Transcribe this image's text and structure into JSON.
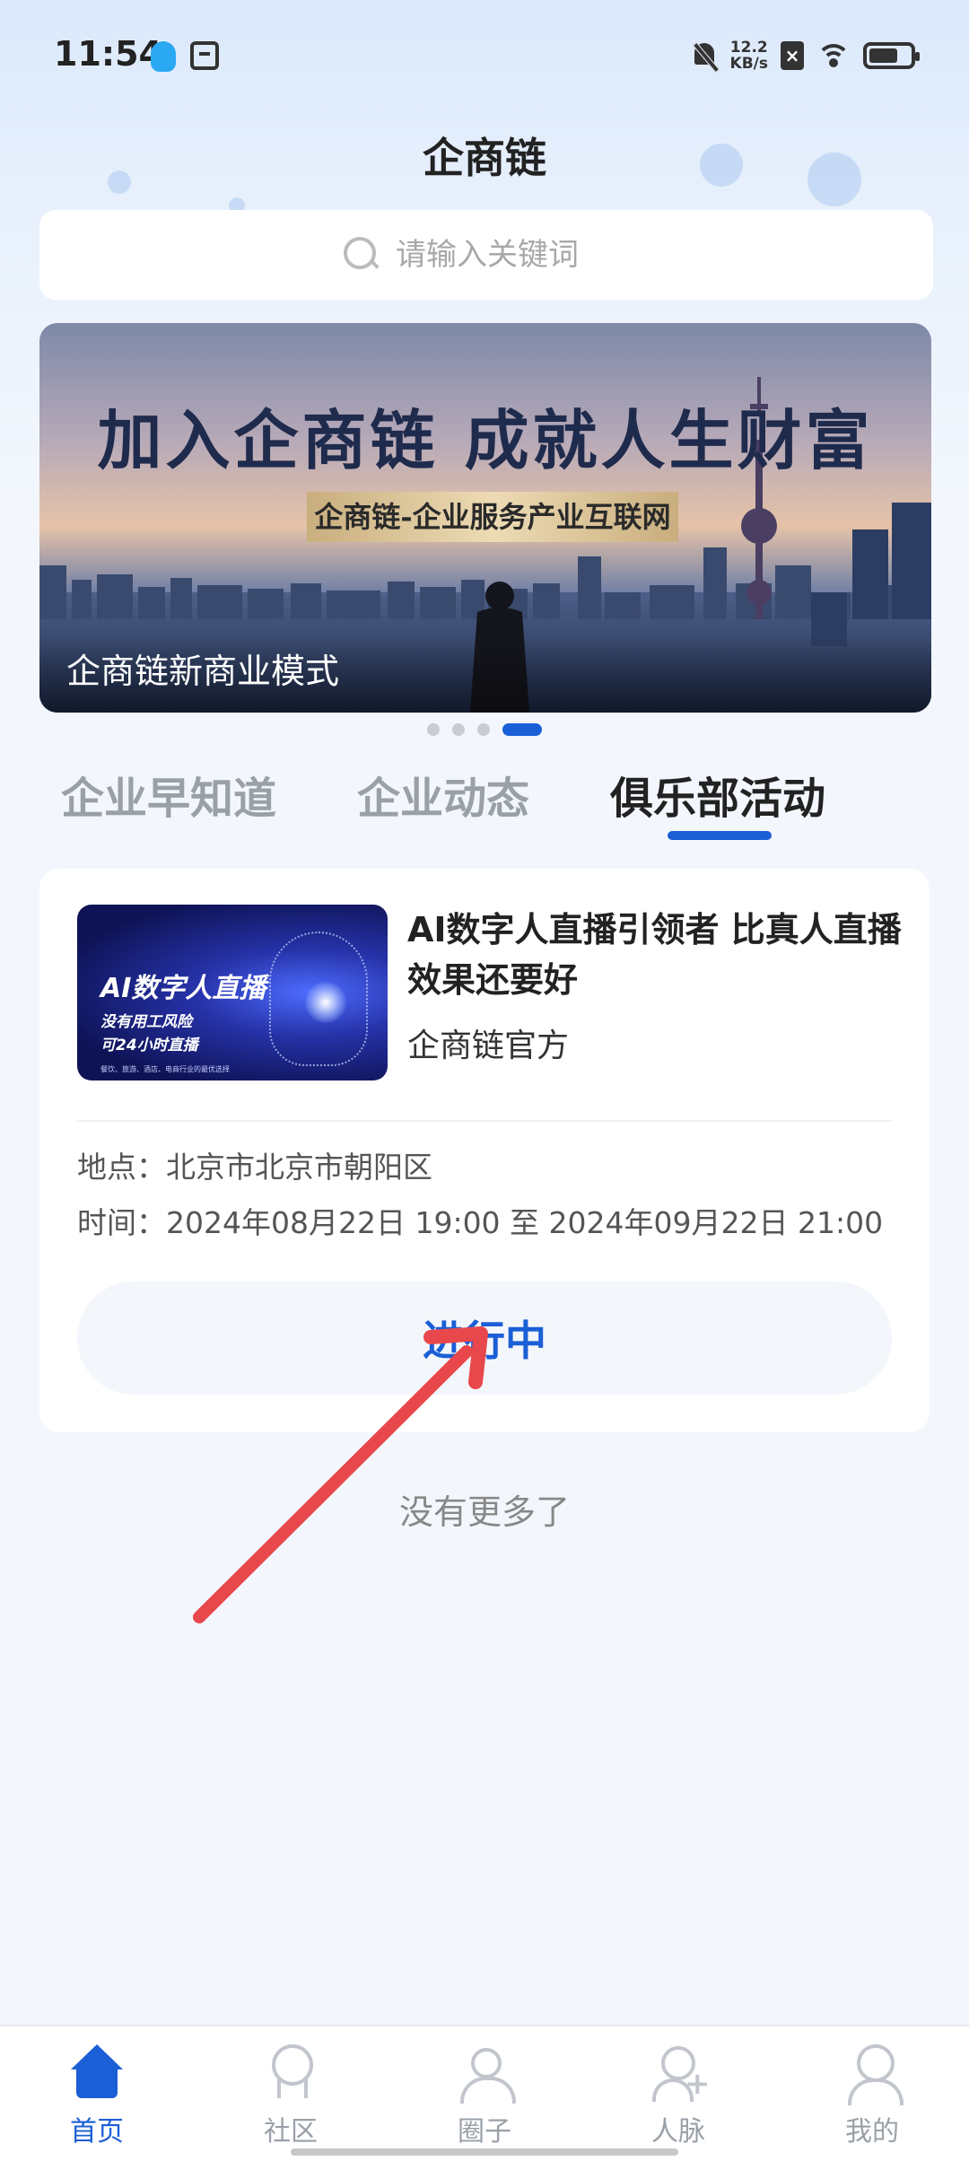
{
  "status_bar": {
    "time": "11:54",
    "net_speed_value": "12.2",
    "net_speed_unit": "KB/s"
  },
  "app": {
    "title": "企商链"
  },
  "search": {
    "placeholder": "请输入关键词"
  },
  "banner": {
    "headline": "加入企商链  成就人生财富",
    "subtitle": "企商链-企业服务产业互联网",
    "caption": "企商链新商业模式",
    "active_index": 3,
    "count": 4
  },
  "tabs": [
    {
      "label": "企业早知道",
      "active": false
    },
    {
      "label": "企业动态",
      "active": false
    },
    {
      "label": "俱乐部活动",
      "active": true
    }
  ],
  "event": {
    "thumb_title": "AI数字人直播",
    "thumb_line1": "没有用工风险",
    "thumb_line2": "可24小时直播",
    "thumb_fine": "餐饮、旅游、酒店、电商行业的最优选择",
    "title": "AI数字人直播引领者 比真人直播效果还要好",
    "organizer": "企商链官方",
    "location": "地点：北京市北京市朝阳区",
    "time": "时间：2024年08月22日 19:00 至 2024年09月22日 21:00",
    "status": "进行中"
  },
  "list_end": "没有更多了",
  "bottom_nav": [
    {
      "label": "首页",
      "icon": "home-icon",
      "active": true
    },
    {
      "label": "社区",
      "icon": "community-icon",
      "active": false
    },
    {
      "label": "圈子",
      "icon": "circle-icon",
      "active": false
    },
    {
      "label": "人脉",
      "icon": "contacts-icon",
      "active": false
    },
    {
      "label": "我的",
      "icon": "mine-icon",
      "active": false
    }
  ],
  "colors": {
    "accent": "#1b5fd6",
    "annotation_arrow": "#e8484b",
    "inactive_text": "#9aa0a8"
  }
}
